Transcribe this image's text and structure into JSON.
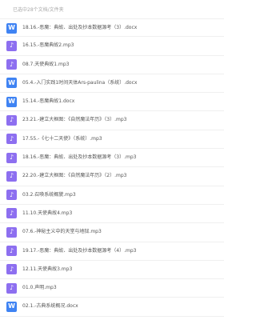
{
  "header": {
    "path_text": "已选中28个文档/文件夹"
  },
  "files": [
    {
      "type": "word",
      "icon": "word-doc-icon",
      "glyph": "W",
      "name": "18.16.-恶魔：典故、出处及抄本数据源考（3）.docx"
    },
    {
      "type": "audio",
      "icon": "music-note-icon",
      "glyph": "♪",
      "name": "16.15.-恶魔典故2.mp3"
    },
    {
      "type": "audio",
      "icon": "music-note-icon",
      "glyph": "♪",
      "name": "08.7.天使典故1.mp3"
    },
    {
      "type": "word",
      "icon": "word-doc-icon",
      "glyph": "W",
      "name": "05.4.-入门实践1时间天体Ars-paulina（系统）.docx"
    },
    {
      "type": "word",
      "icon": "word-doc-icon",
      "glyph": "W",
      "name": "15.14.-恶魔典故1.docx"
    },
    {
      "type": "audio",
      "icon": "music-note-icon",
      "glyph": "♪",
      "name": "23.21.-建立大框图：《自然魔法年历》（3）.mp3"
    },
    {
      "type": "audio",
      "icon": "music-note-icon",
      "glyph": "♪",
      "name": "17.55.-《七十二天使》（系统）.mp3"
    },
    {
      "type": "audio",
      "icon": "music-note-icon",
      "glyph": "♪",
      "name": "18.16.-恶魔：典故、出处及抄本数据源考（3）.mp3"
    },
    {
      "type": "audio",
      "icon": "music-note-icon",
      "glyph": "♪",
      "name": "22.20.-建立大框图：《自然魔法年历》（2）.mp3"
    },
    {
      "type": "audio",
      "icon": "music-note-icon",
      "glyph": "♪",
      "name": "03.2.召唤系统概貌.mp3"
    },
    {
      "type": "audio",
      "icon": "music-note-icon",
      "glyph": "♪",
      "name": "11.10.天使典故4.mp3"
    },
    {
      "type": "audio",
      "icon": "music-note-icon",
      "glyph": "♪",
      "name": "07.6.-神秘主义中的天堂与地狱.mp3"
    },
    {
      "type": "audio",
      "icon": "music-note-icon",
      "glyph": "♪",
      "name": "19.17.-恶魔：典故、出处及抄本数据源考（4）.mp3"
    },
    {
      "type": "audio",
      "icon": "music-note-icon",
      "glyph": "♪",
      "name": "12.11.天使典故3.mp3"
    },
    {
      "type": "audio",
      "icon": "music-note-icon",
      "glyph": "♪",
      "name": "01.0.声明.mp3"
    },
    {
      "type": "word",
      "icon": "word-doc-icon",
      "glyph": "W",
      "name": "02.1.-古典系统概况.docx"
    }
  ]
}
